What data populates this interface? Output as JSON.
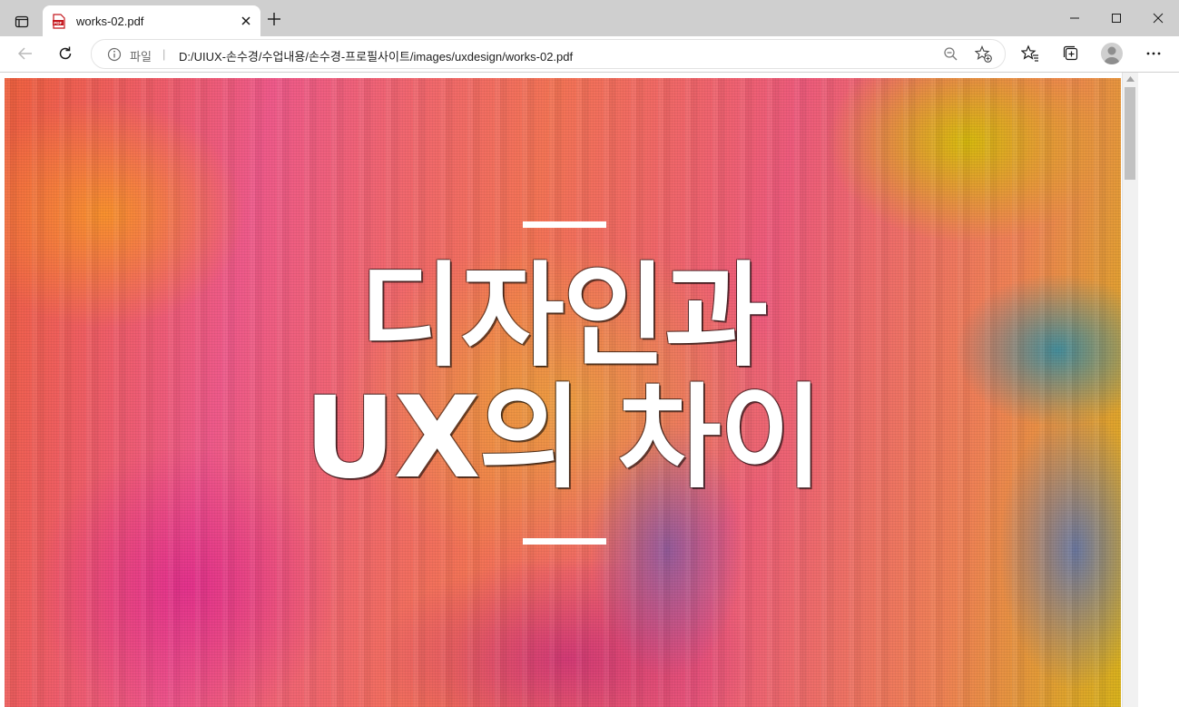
{
  "window": {
    "tab_title": "works-02.pdf",
    "icons": {
      "tab_actions": "tab-actions-icon",
      "pdf": "pdf-file-icon",
      "close_tab": "close-icon",
      "new_tab": "plus-icon",
      "minimize": "minimize-icon",
      "maximize": "maximize-icon",
      "close_window": "close-icon"
    }
  },
  "toolbar": {
    "scheme_label": "파일",
    "separator": "|",
    "url": "D:/UIUX-손수경/수업내용/손수경-프로필사이트/images/uxdesign/works-02.pdf",
    "icons": {
      "back": "back-arrow-icon",
      "refresh": "refresh-icon",
      "info": "info-icon",
      "zoom": "zoom-out-icon",
      "add_favorite": "star-plus-icon",
      "favorites": "favorites-icon",
      "collections": "collections-icon",
      "profile": "avatar",
      "menu": "more-icon"
    }
  },
  "document": {
    "title_line1": "디자인과",
    "title_line2": "UX의 차이",
    "accent_color": "#ffffff"
  }
}
